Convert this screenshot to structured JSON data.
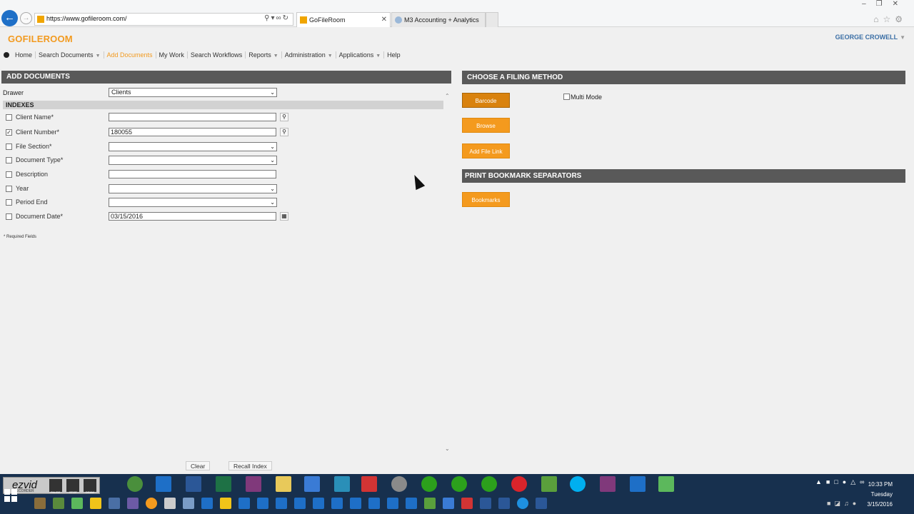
{
  "browser": {
    "url": "https://www.gofileroom.com/",
    "tabs": [
      {
        "label": "GoFileRoom",
        "active": true
      },
      {
        "label": "M3 Accounting + Analytics",
        "active": false
      }
    ]
  },
  "app": {
    "logo": "GOFILEROOM",
    "user": "GEORGE CROWELL",
    "nav": [
      {
        "label": "Home",
        "dropdown": false,
        "active": false
      },
      {
        "label": "Search Documents",
        "dropdown": true,
        "active": false
      },
      {
        "label": "Add Documents",
        "dropdown": false,
        "active": true
      },
      {
        "label": "My Work",
        "dropdown": false,
        "active": false
      },
      {
        "label": "Search Workflows",
        "dropdown": false,
        "active": false
      },
      {
        "label": "Reports",
        "dropdown": true,
        "active": false
      },
      {
        "label": "Administration",
        "dropdown": true,
        "active": false
      },
      {
        "label": "Applications",
        "dropdown": true,
        "active": false
      },
      {
        "label": "Help",
        "dropdown": false,
        "active": false
      }
    ]
  },
  "add_documents": {
    "title": "ADD DOCUMENTS",
    "drawer_label": "Drawer",
    "drawer_value": "Clients",
    "indexes_title": "INDEXES",
    "fields": [
      {
        "label": "Client Name*",
        "type": "text",
        "value": "",
        "checked": false,
        "side": "search"
      },
      {
        "label": "Client Number*",
        "type": "text",
        "value": "180055",
        "checked": true,
        "side": "search"
      },
      {
        "label": "File Section*",
        "type": "select",
        "value": "",
        "checked": false,
        "side": ""
      },
      {
        "label": "Document Type*",
        "type": "select",
        "value": "",
        "checked": false,
        "side": ""
      },
      {
        "label": "Description",
        "type": "text",
        "value": "",
        "checked": false,
        "side": ""
      },
      {
        "label": "Year",
        "type": "select",
        "value": "",
        "checked": false,
        "side": ""
      },
      {
        "label": "Period End",
        "type": "select",
        "value": "",
        "checked": false,
        "side": ""
      },
      {
        "label": "Document Date*",
        "type": "text",
        "value": "03/15/2016",
        "checked": false,
        "side": "calendar"
      }
    ],
    "required_note": "* Required Fields",
    "clear_label": "Clear",
    "recall_label": "Recall Index"
  },
  "filing": {
    "title": "CHOOSE A FILING METHOD",
    "barcode_label": "Barcode",
    "browse_label": "Browse",
    "add_file_link_label": "Add File Link",
    "multi_mode_label": "Multi Mode",
    "multi_mode_checked": false,
    "print_title": "PRINT BOOKMARK SEPARATORS",
    "bookmarks_label": "Bookmarks"
  },
  "taskbar": {
    "ezvid_logo": "ezvid",
    "ezvid_sub": "RECORDER",
    "ezvid_controls": [
      "PAUSE",
      "STOP",
      "DRAW"
    ],
    "clock_time": "10:33 PM",
    "clock_day": "Tuesday",
    "clock_date": "3/15/2016",
    "colors": {
      "bar": "#17304e",
      "accent": "#f49a1e"
    }
  }
}
